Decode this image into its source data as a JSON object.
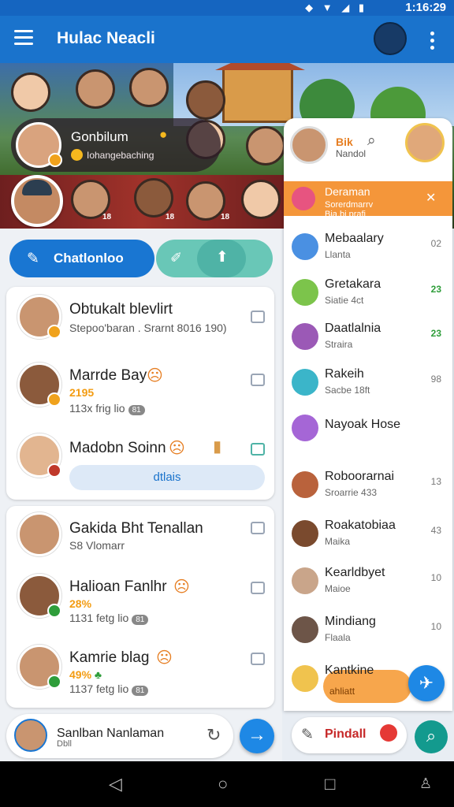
{
  "status_bar": {
    "time": "1:16:29",
    "icons": "◆ ▼ ◢ ▮"
  },
  "app_bar": {
    "title": "Hulac Neacli"
  },
  "banner": {
    "featured_title": "Gonbilum",
    "featured_subtitle": "Iohangebaching",
    "tags": [
      "18",
      "18",
      "18"
    ]
  },
  "actions": {
    "compose_label": "Chatlonloo"
  },
  "chat_list": {
    "card1": [
      {
        "name": "Obtukalt blevlirt",
        "sub": "Stepoo'baran . Srarnt 8016 190)"
      },
      {
        "name": "Marrde Bay",
        "stat": "2195",
        "sub": "113x frig lio",
        "pill": "81"
      },
      {
        "name": "Madobn Soinn",
        "details_label": "dtlais"
      }
    ],
    "card2": [
      {
        "name": "Gakida Bht Tenallan",
        "sub": "S8 Vlomarr"
      },
      {
        "name": "Halioan Fanlhr",
        "stat": "28%",
        "sub": "1131 fetg lio",
        "pill": "81"
      },
      {
        "name": "Kamrie blag",
        "stat": "49%",
        "sub": "1137 fetg lio",
        "pill": "81"
      }
    ]
  },
  "bottom_left": {
    "name": "Sanlban Nanlaman",
    "sub": "Dbll"
  },
  "right_panel": {
    "header_title": "Bik",
    "header_sub": "Nandol",
    "banner_title": "Deraman",
    "banner_sub": "Sorerdmarrv",
    "banner_sub2": "Bia.bi prafi",
    "items": [
      {
        "name": "Mebaalary",
        "sub": "Llanta",
        "count": "02"
      },
      {
        "name": "Gretakara",
        "sub": "Siatie 4ct",
        "count": "23"
      },
      {
        "name": "Daatlalnia",
        "sub": "Straira",
        "count": "23"
      },
      {
        "name": "Rakeih",
        "sub": "Sacbe 18ft",
        "count": "98"
      },
      {
        "name": "Nayoak Hose",
        "sub": "",
        "count": ""
      },
      {
        "name": "Roboorarnai",
        "sub": "Sroarrie 433",
        "count": "13"
      },
      {
        "name": "Roakatobiaa",
        "sub": "Maika",
        "count": "43"
      },
      {
        "name": "Kearldbyet",
        "sub": "Maioe",
        "count": "10"
      },
      {
        "name": "Mindiang",
        "sub": "Flaala",
        "count": "10"
      },
      {
        "name": "Kantkine",
        "sub": "ahliatt",
        "count": ""
      }
    ],
    "bottom_label": "Pindall"
  },
  "colors": {
    "primary": "#1a73cc",
    "accent": "#f4963a",
    "teal": "#139a8e"
  }
}
